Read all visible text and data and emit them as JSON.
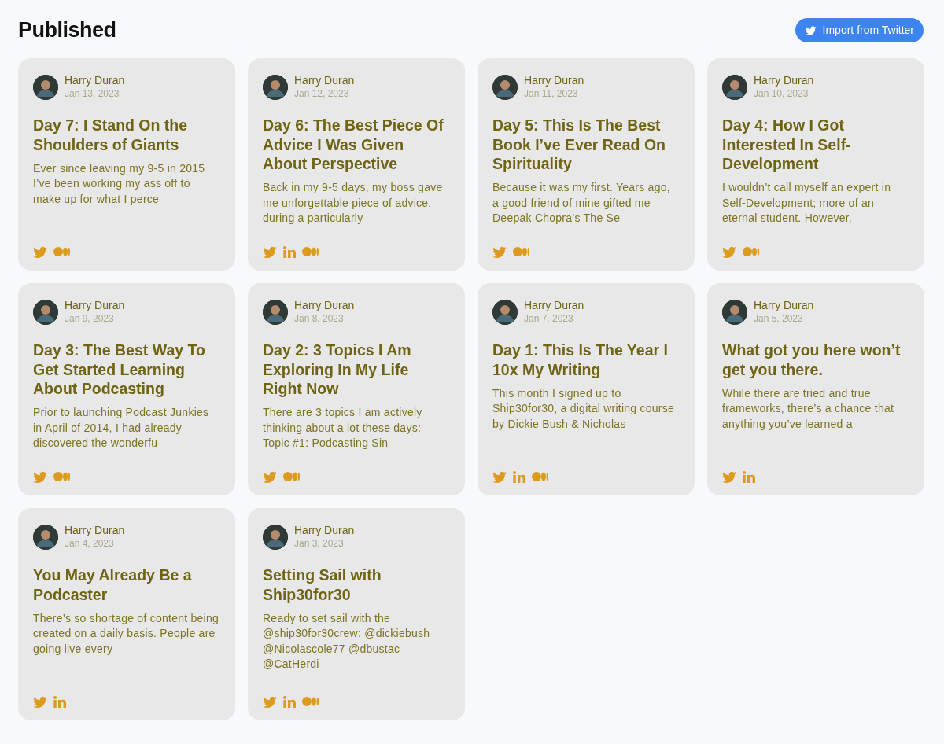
{
  "page": {
    "title": "Published"
  },
  "import_button": {
    "label": "Import from Twitter"
  },
  "posts": [
    {
      "author": "Harry Duran",
      "date": "Jan 13, 2023",
      "title": "Day 7: I Stand On the Shoulders of Giants",
      "excerpt": "Ever since leaving my 9-5 in 2015 I’ve been working my ass off to make up for what I perce",
      "platforms": [
        {
          "kind": "twitter"
        },
        {
          "kind": "medium"
        }
      ]
    },
    {
      "author": "Harry Duran",
      "date": "Jan 12, 2023",
      "title": "Day 6: The Best Piece Of Advice I Was Given About Perspective",
      "excerpt": "Back in my 9-5 days, my boss gave me unforgettable piece of advice, during a particularly",
      "platforms": [
        {
          "kind": "twitter"
        },
        {
          "kind": "linkedin"
        },
        {
          "kind": "medium"
        }
      ]
    },
    {
      "author": "Harry Duran",
      "date": "Jan 11, 2023",
      "title": "Day 5: This Is The Best Book I’ve Ever Read On Spirituality",
      "excerpt": "Because it was my first. Years ago, a good friend of mine gifted me Deepak Chopra’s The Se",
      "platforms": [
        {
          "kind": "twitter"
        },
        {
          "kind": "medium"
        }
      ]
    },
    {
      "author": "Harry Duran",
      "date": "Jan 10, 2023",
      "title": "Day 4: How I Got Interested In Self-Development",
      "excerpt": "I wouldn’t call myself an expert in Self-Development; more of an eternal student. However,",
      "platforms": [
        {
          "kind": "twitter"
        },
        {
          "kind": "medium"
        }
      ]
    },
    {
      "author": "Harry Duran",
      "date": "Jan 9, 2023",
      "title": "Day 3: The Best Way To Get Started Learning About Podcasting",
      "excerpt": "Prior to launching Podcast Junkies in April of 2014, I had already discovered the wonderfu",
      "platforms": [
        {
          "kind": "twitter"
        },
        {
          "kind": "medium"
        }
      ]
    },
    {
      "author": "Harry Duran",
      "date": "Jan 8, 2023",
      "title": "Day 2: 3 Topics I Am Exploring In My Life Right Now",
      "excerpt": "There are 3 topics I am actively thinking about a lot these days: Topic #1: Podcasting Sin",
      "platforms": [
        {
          "kind": "twitter"
        },
        {
          "kind": "medium"
        }
      ]
    },
    {
      "author": "Harry Duran",
      "date": "Jan 7, 2023",
      "title": "Day 1: This Is The Year I 10x My Writing",
      "excerpt": "This month I signed up to Ship30for30, a digital writing course by Dickie Bush & Nicholas",
      "platforms": [
        {
          "kind": "twitter"
        },
        {
          "kind": "linkedin"
        },
        {
          "kind": "medium"
        }
      ]
    },
    {
      "author": "Harry Duran",
      "date": "Jan 5, 2023",
      "title": "What got you here won’t get you there.",
      "excerpt": "While there are tried and true frameworks, there’s a chance that anything you’ve learned a",
      "platforms": [
        {
          "kind": "twitter"
        },
        {
          "kind": "linkedin"
        }
      ]
    },
    {
      "author": "Harry Duran",
      "date": "Jan 4, 2023",
      "title": "You May Already Be a Podcaster",
      "excerpt": "There’s so shortage of content being created on a daily basis. People are going live every",
      "platforms": [
        {
          "kind": "twitter"
        },
        {
          "kind": "linkedin"
        }
      ]
    },
    {
      "author": "Harry Duran",
      "date": "Jan 3, 2023",
      "title": "Setting Sail with Ship30for30",
      "excerpt": "Ready to set sail with the @ship30for30crew: @dickiebush @Nicolascole77 @dbustac @CatHerdi",
      "platforms": [
        {
          "kind": "twitter"
        },
        {
          "kind": "linkedin"
        },
        {
          "kind": "medium"
        }
      ]
    }
  ]
}
